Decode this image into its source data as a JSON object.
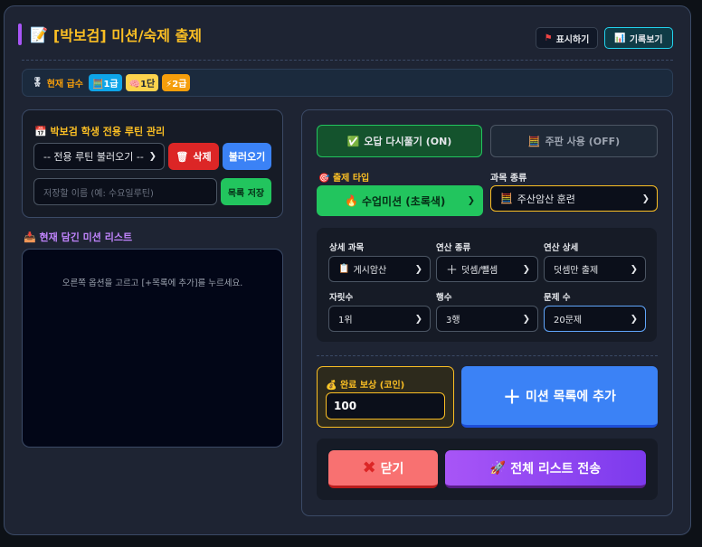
{
  "header": {
    "title_icon": "memo-icon",
    "title": "[박보검] 미션/숙제 출제",
    "show_button": "표시하기",
    "record_button": "기록보기"
  },
  "grades": {
    "label": "현재 급수",
    "abacus": "1급",
    "mental": "1단",
    "flash": "2급"
  },
  "routine": {
    "title": "박보검 학생 전용 루틴 관리",
    "select_value": "-- 전용 루틴 불러오기 --",
    "delete_button": "삭제",
    "load_button": "불러오기",
    "name_placeholder": "저장할 이름 (예: 수요일루틴)",
    "save_button": "목록 저장"
  },
  "mission_list": {
    "title": "현재 담긴 미션 리스트",
    "empty_text": "오른쪽 옵션을 고르고 [+목록에 추가]를 누르세요."
  },
  "toggles": {
    "review": "오답 다시풀기 (ON)",
    "abacus": "주판 사용 (OFF)"
  },
  "form": {
    "mission_type_label": "출제 타입",
    "mission_type_value": "수업미션 (초록색)",
    "subject_label": "과목 종류",
    "subject_value": "주산암산 훈련",
    "detail_subject_label": "상세 과목",
    "detail_subject_value": "게시암산",
    "operation_label": "연산 종류",
    "operation_value": "덧셈/뺄셈",
    "operation_detail_label": "연산 상세",
    "operation_detail_value": "덧셈만 출제",
    "digits_label": "자릿수",
    "digits_value": "1위",
    "rows_label": "행수",
    "rows_value": "3행",
    "count_label": "문제 수",
    "count_value": "20문제"
  },
  "reward": {
    "label": "완료 보상 (코인)",
    "value": "100"
  },
  "actions": {
    "add_button": "미션 목록에 추가",
    "close_button": "닫기",
    "send_button": "전체 리스트 전송"
  },
  "colors": {
    "accent_purple": "#a855f7",
    "gold": "#fbbf24",
    "green": "#22c55e",
    "blue": "#3b82f6",
    "red": "#dc2626",
    "salmon": "#f87171"
  }
}
